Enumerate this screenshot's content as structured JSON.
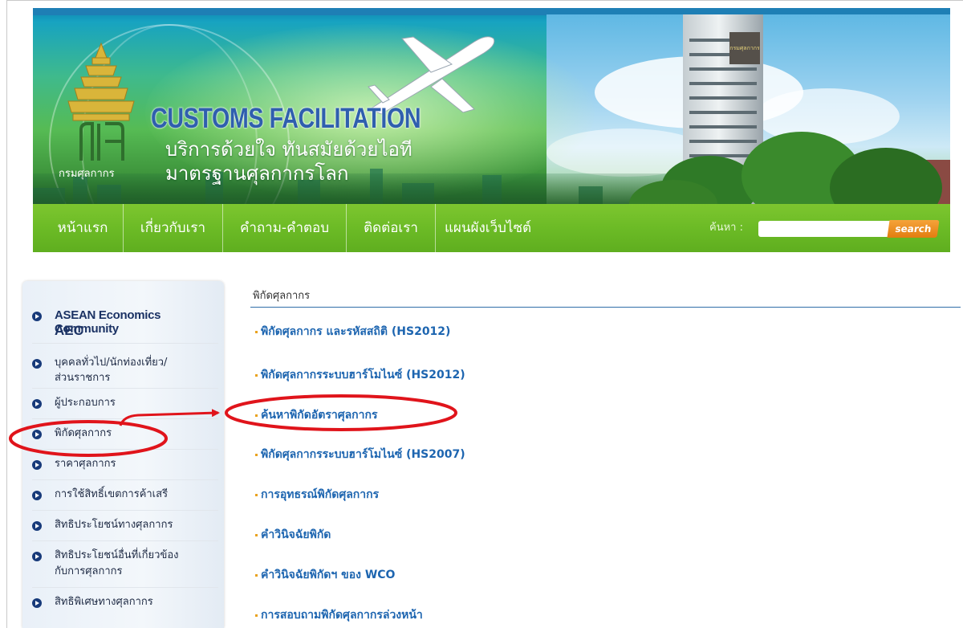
{
  "banner": {
    "title": "CUSTOMS FACILITATION",
    "tagline_1": "บริการด้วยใจ ทันสมัยด้วยไอที",
    "tagline_2": "มาตรฐานศุลกากรโลก",
    "logo_caption": "กรมศุลกากร",
    "logo_icon": "customs-department-emblem",
    "building_sign": "กรมศุลกากร"
  },
  "nav": {
    "items": [
      {
        "label": "หน้าแรก"
      },
      {
        "label": "เกี่ยวกับเรา"
      },
      {
        "label": "คำถาม-คำตอบ"
      },
      {
        "label": "ติดต่อเรา"
      },
      {
        "label": "แผนผังเว็บไซต์"
      }
    ],
    "search_label": "ค้นหา :",
    "search_value": "",
    "search_button": "search"
  },
  "sidebar": {
    "aec_line1": "ASEAN Economics Community",
    "aec_line2": "AEC",
    "items": [
      {
        "line1": "บุคคลทั่วไป/นักท่องเที่ยว/",
        "line2": "ส่วนราชการ"
      },
      {
        "line1": "ผู้ประกอบการ"
      },
      {
        "line1": "พิกัดศุลกากร"
      },
      {
        "line1": "ราคาศุลกากร"
      },
      {
        "line1": "การใช้สิทธิ์เขตการค้าเสรี"
      },
      {
        "line1": "สิทธิประโยชน์ทางศุลกากร"
      },
      {
        "line1": "สิทธิประโยชน์อื่นที่เกี่ยวข้อง",
        "line2": "กับการศุลกากร"
      },
      {
        "line1": "สิทธิพิเศษทางศุลกากร"
      }
    ]
  },
  "content": {
    "title": "พิกัดศุลกากร",
    "links": [
      {
        "label": "พิกัดศุลกากร และรหัสสถิติ (HS2012)"
      },
      {
        "label": "พิกัดศุลกากรระบบฮาร์โมไนซ์ (HS2012)"
      },
      {
        "label": "ค้นหาพิกัดอัตราศุลกากร"
      },
      {
        "label": "พิกัดศุลกากรระบบฮาร์โมไนซ์ (HS2007)"
      },
      {
        "label": "การอุทธรณ์พิกัดศุลกากร"
      },
      {
        "label": "คำวินิจฉัยพิกัด"
      },
      {
        "label": "คำวินิจฉัยพิกัดฯ ของ WCO"
      },
      {
        "label": "การสอบถามพิกัดศุลกากรล่วงหน้า"
      }
    ]
  },
  "colors": {
    "nav_green": "#6cbb26",
    "link_blue": "#1d65b0",
    "annotation_red": "#e0141b",
    "search_orange": "#e27d10"
  }
}
